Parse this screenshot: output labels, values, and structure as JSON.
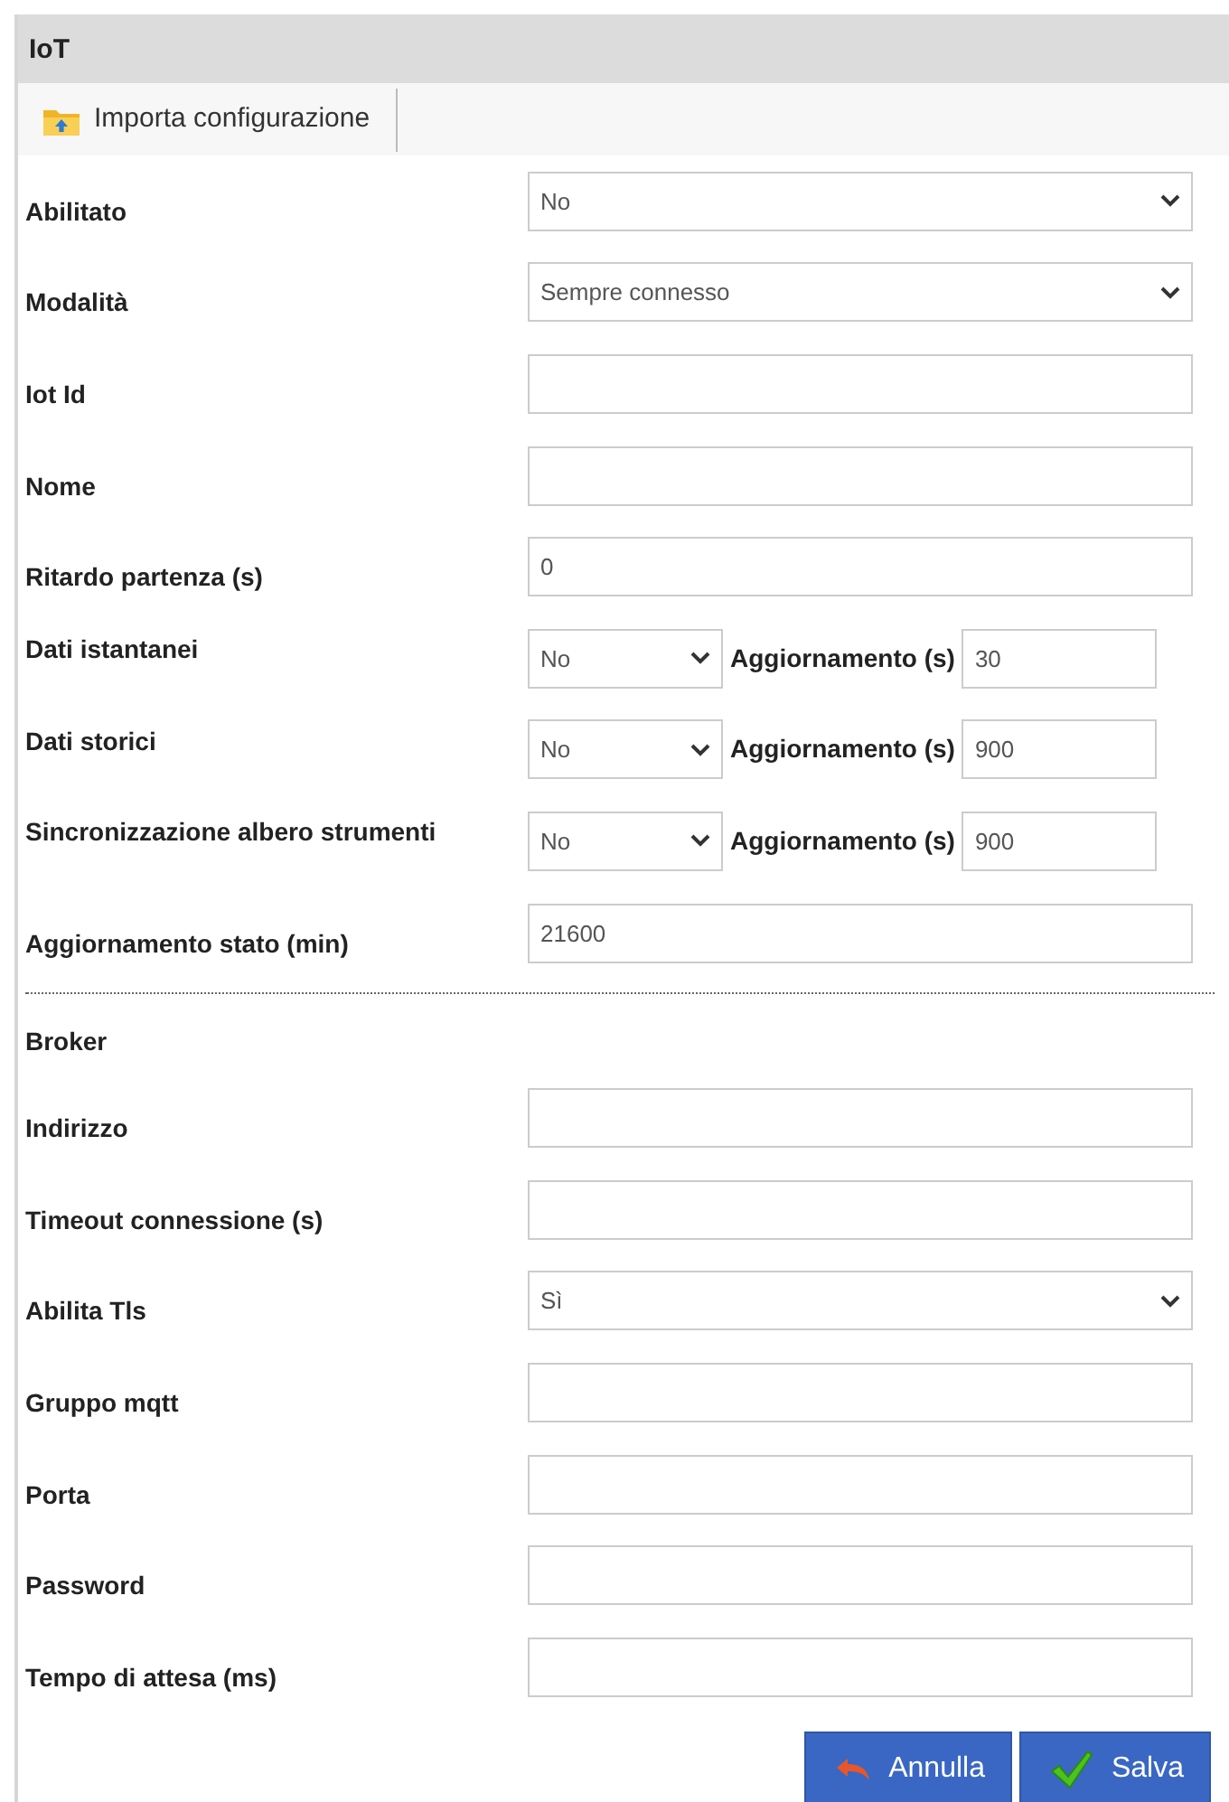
{
  "title": "IoT",
  "toolbar": [
    {
      "label": "Importa configurazione"
    }
  ],
  "fields": [
    {
      "kind": "select",
      "label": "Abilitato",
      "value": "No"
    },
    {
      "kind": "select",
      "label": "Modalità",
      "value": "Sempre connesso"
    },
    {
      "kind": "text",
      "label": "Iot Id"
    },
    {
      "kind": "text",
      "label": "Nome"
    },
    {
      "kind": "text",
      "label": "Ritardo partenza (s)",
      "value": "0"
    },
    {
      "kind": "split",
      "label": "Dati istantanei",
      "value": "No",
      "sub_label": "Aggiornamento (s)",
      "sub_value": "30"
    },
    {
      "kind": "split",
      "label": "Dati storici",
      "value": "No",
      "sub_label": "Aggiornamento (s)",
      "sub_value": "900"
    },
    {
      "kind": "split",
      "label": "Sincronizzazione albero strumenti",
      "value": "No",
      "sub_label": "Aggiornamento (s)",
      "sub_value": "900"
    },
    {
      "kind": "text",
      "label": "Aggiornamento stato (min)",
      "value": "21600"
    },
    {
      "kind": "heading",
      "label": "Broker"
    },
    {
      "kind": "text",
      "label": "Indirizzo"
    },
    {
      "kind": "text",
      "label": "Timeout connessione (s)"
    },
    {
      "kind": "select",
      "label": "Abilita Tls",
      "value": "Sì"
    },
    {
      "kind": "text",
      "label": "Gruppo mqtt"
    },
    {
      "kind": "text",
      "label": "Porta"
    },
    {
      "kind": "text",
      "label": "Password"
    },
    {
      "kind": "text",
      "label": "Tempo di attesa (ms)"
    }
  ],
  "buttons": [
    {
      "kind": "cancel",
      "label": "Annulla"
    },
    {
      "kind": "save",
      "label": "Salva"
    }
  ]
}
